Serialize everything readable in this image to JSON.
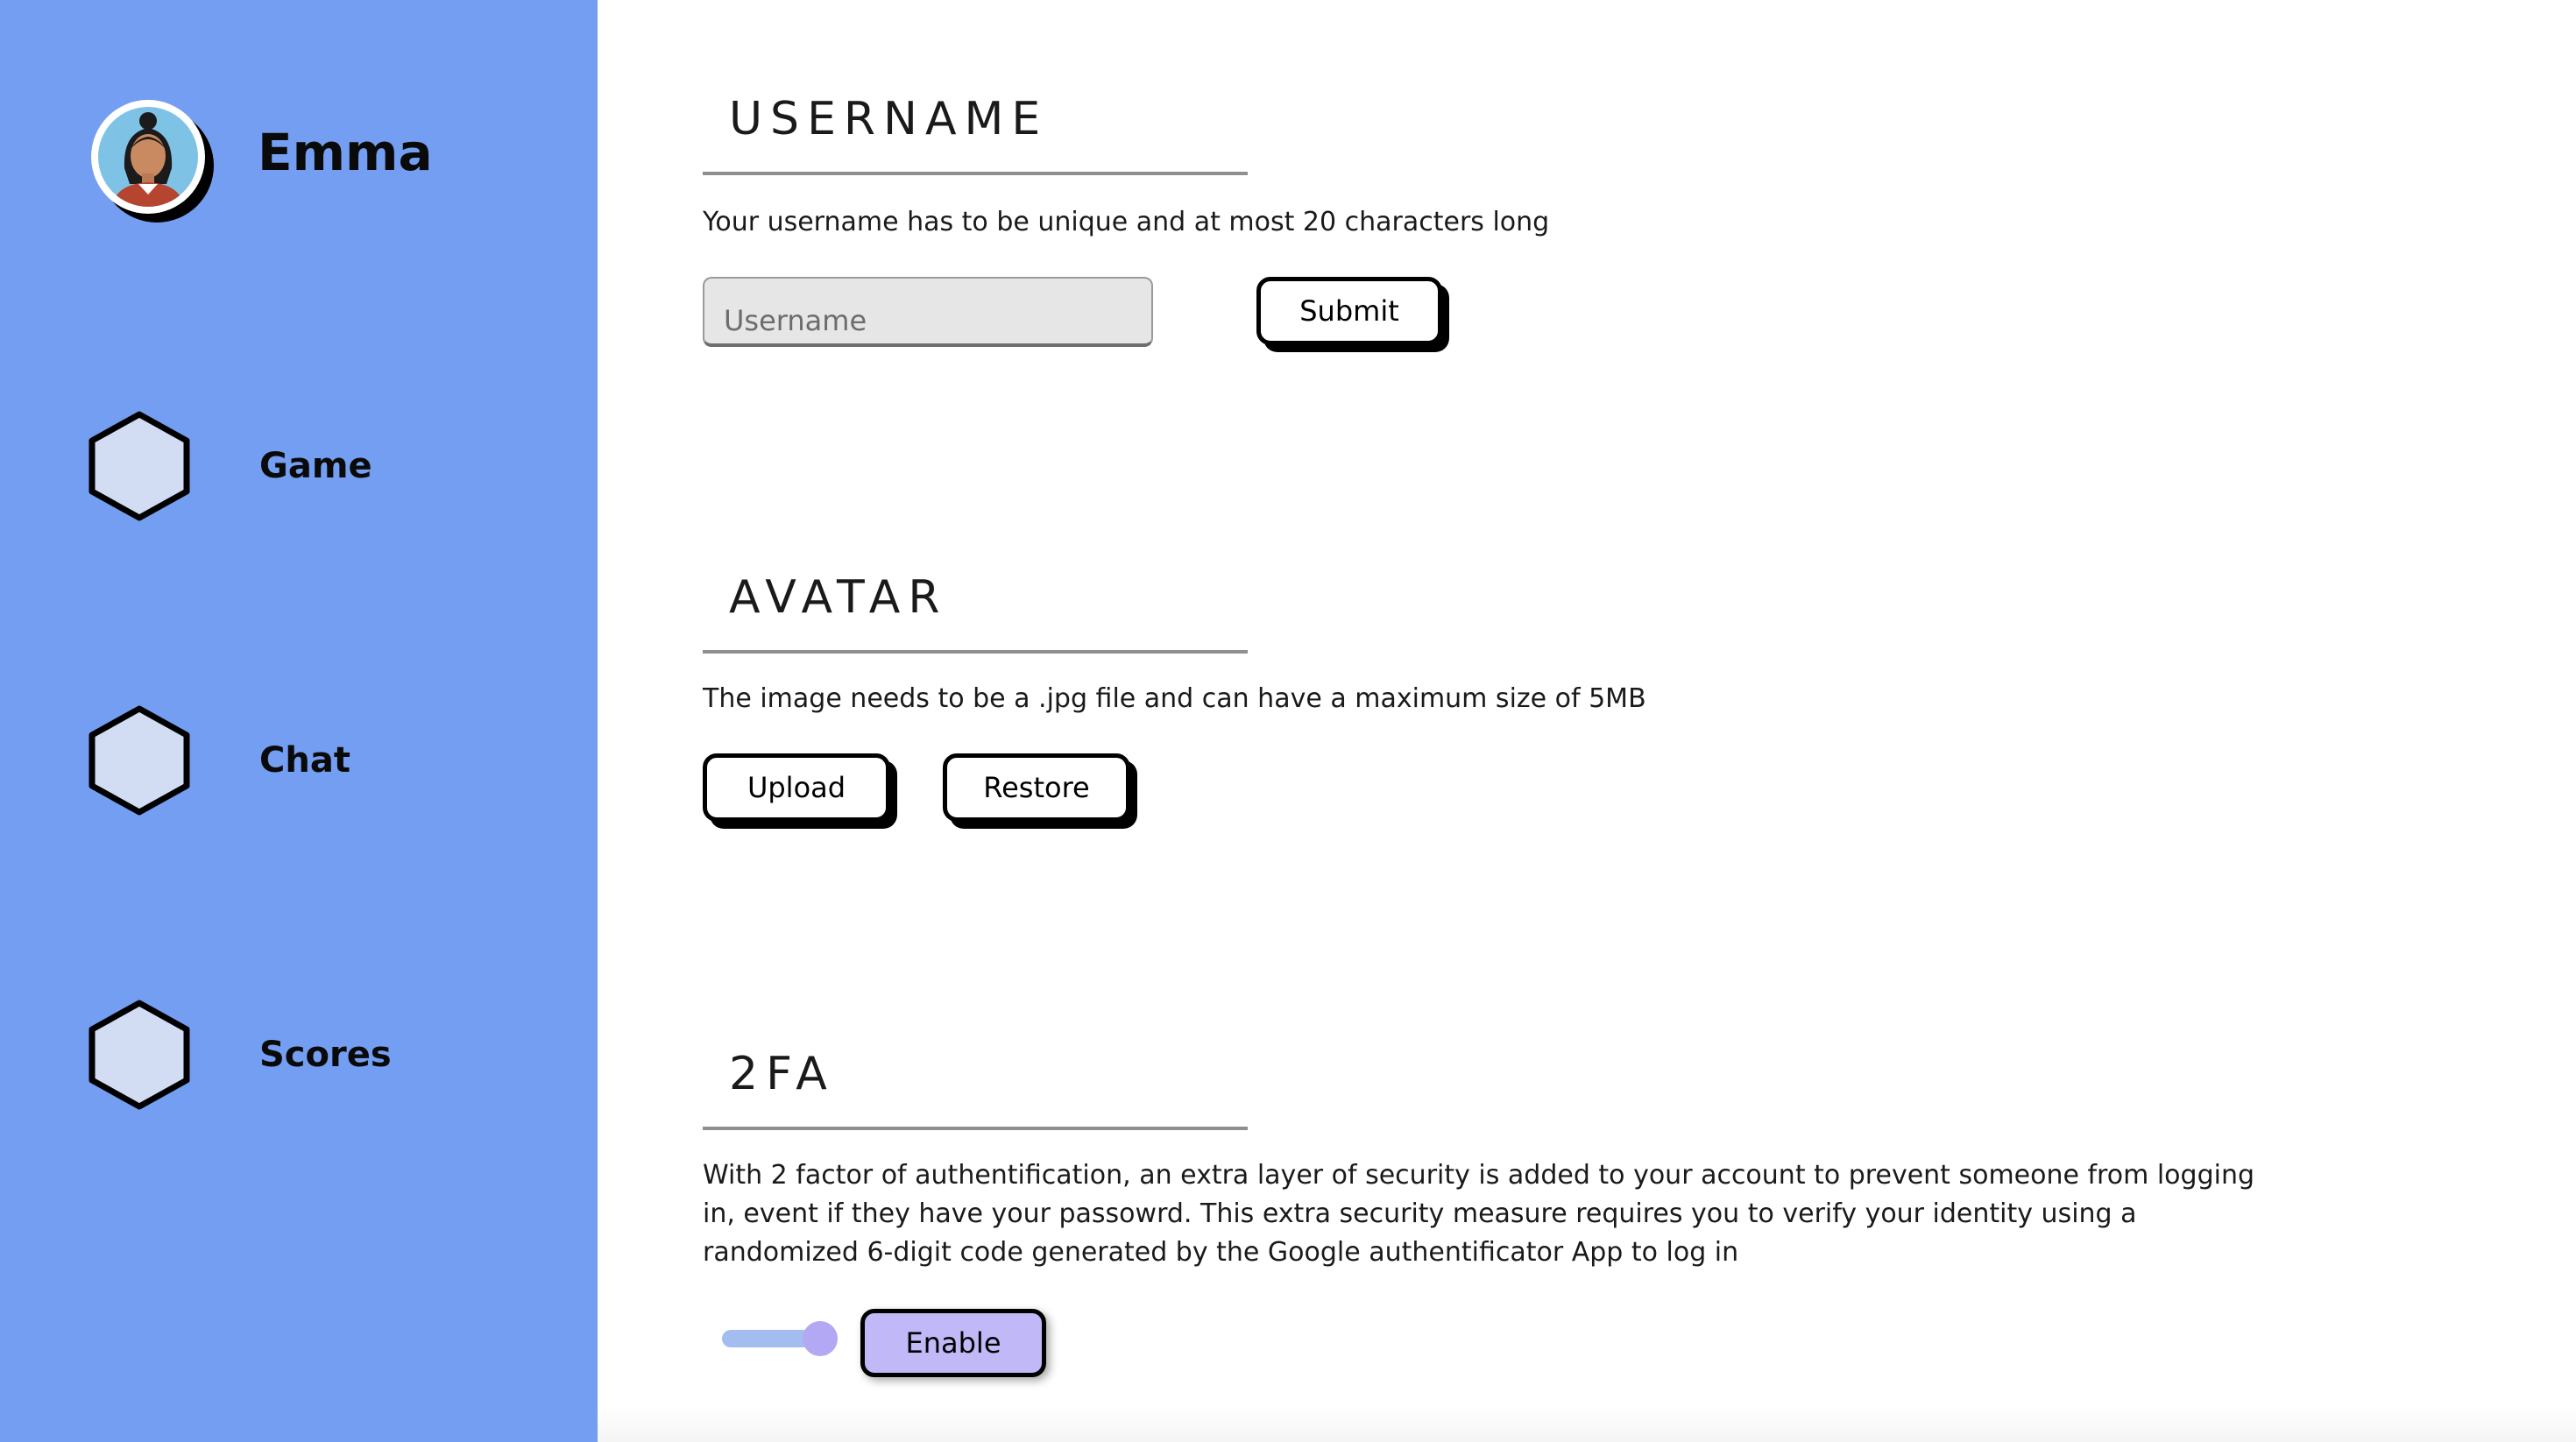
{
  "sidebar": {
    "profile_name": "Emma",
    "items": [
      {
        "label": "Game",
        "icon": "hexagon-icon"
      },
      {
        "label": "Chat",
        "icon": "hexagon-icon"
      },
      {
        "label": "Scores",
        "icon": "hexagon-icon"
      }
    ]
  },
  "username_section": {
    "title": "USERNAME",
    "description": "Your username has to be unique and at most 20 characters long",
    "input_placeholder": "Username",
    "input_value": "",
    "submit_label": "Submit"
  },
  "avatar_section": {
    "title": "AVATAR",
    "description": "The image needs to be a .jpg file and can have a maximum size of 5MB",
    "upload_label": "Upload",
    "restore_label": "Restore"
  },
  "twofa_section": {
    "title": "2FA",
    "description": "With 2 factor of authentification, an extra layer of security is added to your account to prevent someone from logging in, event if they have your passowrd. This extra security measure requires you to verify your identity using a randomized 6-digit code generated by the Google authentificator App to log in",
    "toggle_on": true,
    "enable_label": "Enable"
  },
  "colors": {
    "sidebar_bg": "#749ef2",
    "hexagon_fill": "#d2dcf2",
    "enable_button": "#c1b8f7",
    "toggle_track": "#a4bdf0",
    "toggle_knob": "#b3a8f3"
  }
}
